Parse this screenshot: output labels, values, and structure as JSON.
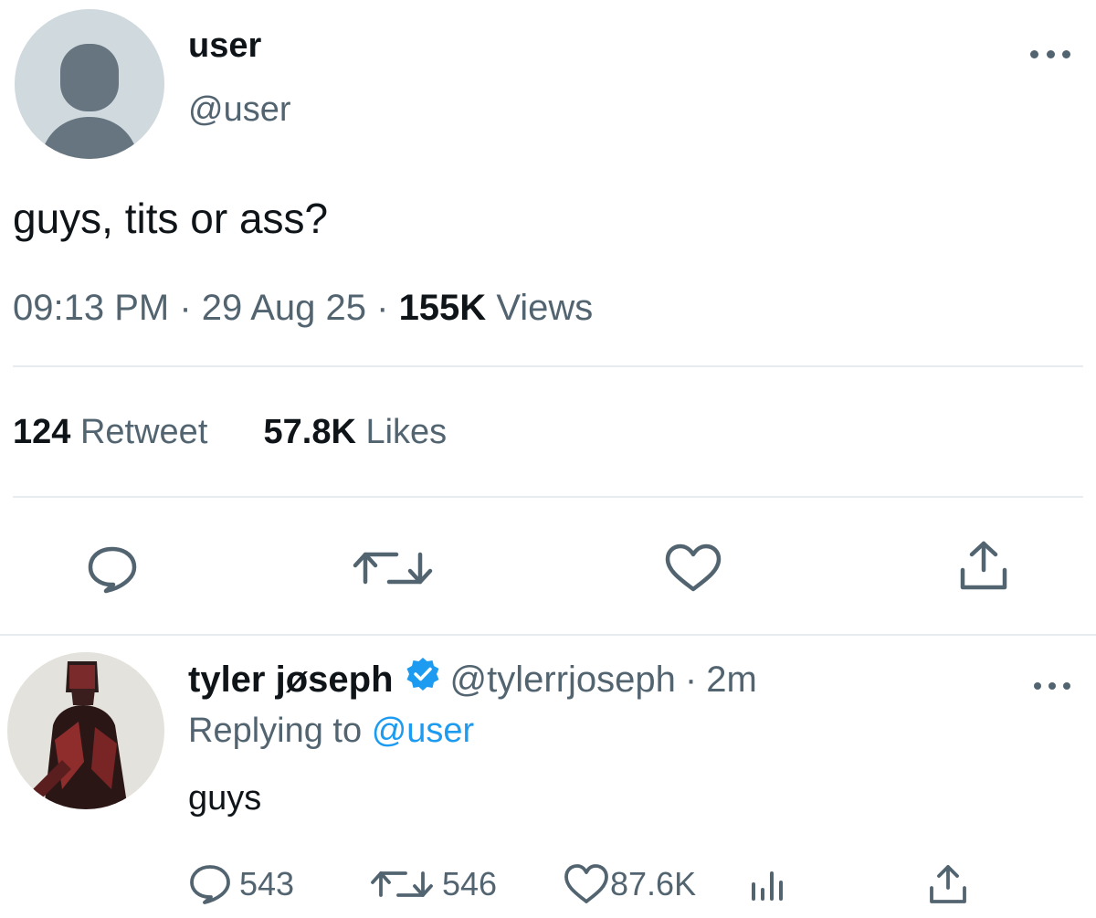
{
  "tweet": {
    "author_name": "user",
    "author_handle": "@user",
    "text": "guys, tits or ass?",
    "time": "09:13 PM",
    "date": "29 Aug 25",
    "separator": "·",
    "views_count": "155K",
    "views_label": "Views",
    "retweets_count": "124",
    "retweets_label": "Retweet",
    "likes_count": "57.8K",
    "likes_label": "Likes",
    "actions": [
      "reply-icon",
      "retweet-icon",
      "like-icon",
      "share-icon"
    ]
  },
  "reply": {
    "author_name": "tyler jøseph",
    "author_handle": "@tylerrjoseph",
    "separator": "·",
    "time_ago": "2m",
    "replying_label": "Replying to",
    "replying_to": "@user",
    "text": "guys",
    "replies_count": "543",
    "retweets_count": "546",
    "likes_count": "87.6K"
  },
  "colors": {
    "text_primary": "#0f1419",
    "text_secondary": "#536471",
    "accent": "#1d9bf0",
    "divider": "#e6ecf0",
    "avatar_placeholder": "#cfd9de"
  }
}
